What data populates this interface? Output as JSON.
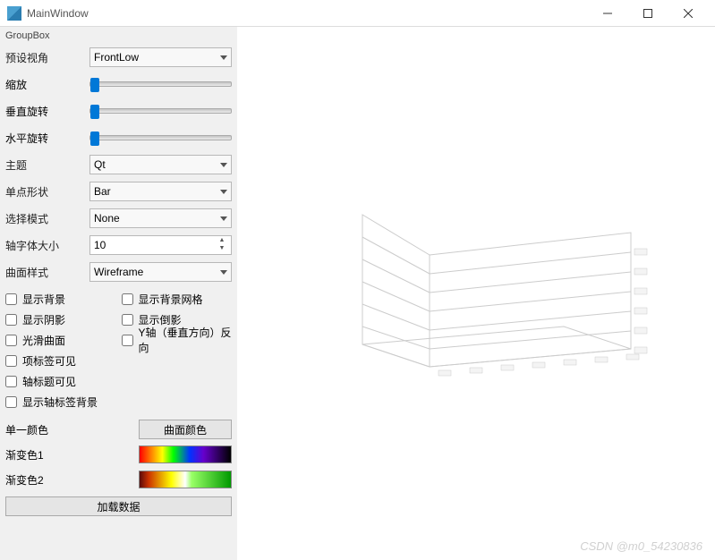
{
  "window": {
    "title": "MainWindow"
  },
  "groupbox": {
    "label": "GroupBox"
  },
  "sliders": {
    "zoom_label": "缩放",
    "vrot_label": "垂直旋转",
    "hrot_label": "水平旋转"
  },
  "fields": {
    "preset_label": "预设视角",
    "preset_value": "FrontLow",
    "theme_label": "主题",
    "theme_value": "Qt",
    "pointshape_label": "单点形状",
    "pointshape_value": "Bar",
    "selectmode_label": "选择模式",
    "selectmode_value": "None",
    "fontsize_label": "轴字体大小",
    "fontsize_value": "10",
    "surfstyle_label": "曲面样式",
    "surfstyle_value": "Wireframe"
  },
  "checks": {
    "show_bg": "显示背景",
    "show_grid": "显示背景网格",
    "show_shadow": "显示阴影",
    "show_invshadow": "显示倒影",
    "smooth": "光滑曲面",
    "yflip": "Y轴（垂直方向）反向",
    "item_label": "项标签可见",
    "axis_title": "轴标题可见",
    "axis_label_bg": "显示轴标签背景"
  },
  "colors": {
    "single_label": "单一颜色",
    "single_button": "曲面颜色",
    "grad1_label": "渐变色1",
    "grad2_label": "渐变色2"
  },
  "load_button": "加载数据",
  "chart_data": {
    "type": "surface",
    "note": "Empty 3D wireframe grid axes shown, no data loaded",
    "axis_ticks_visible": true
  },
  "watermark": "CSDN @m0_54230836"
}
